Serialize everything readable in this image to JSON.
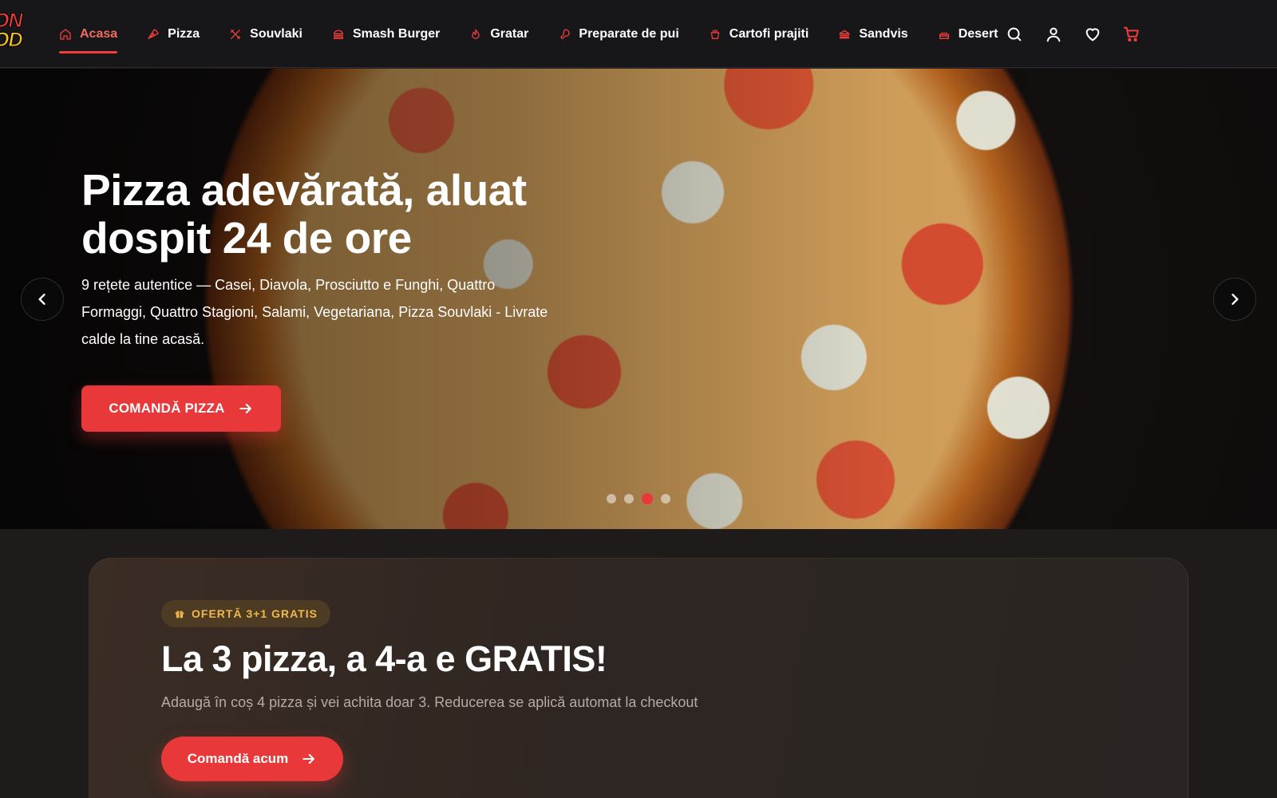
{
  "brand": {
    "logo_line1": "ON",
    "logo_line2": "OD"
  },
  "nav": {
    "items": [
      {
        "label": "Acasa",
        "icon": "home-icon",
        "active": true
      },
      {
        "label": "Pizza",
        "icon": "pizza-icon"
      },
      {
        "label": "Souvlaki",
        "icon": "utensils-icon"
      },
      {
        "label": "Smash Burger",
        "icon": "burger-icon"
      },
      {
        "label": "Gratar",
        "icon": "flame-icon"
      },
      {
        "label": "Preparate de pui",
        "icon": "drumstick-icon"
      },
      {
        "label": "Cartofi prajiti",
        "icon": "fries-icon"
      },
      {
        "label": "Sandvis",
        "icon": "sandwich-icon"
      },
      {
        "label": "Desert",
        "icon": "cake-icon"
      }
    ],
    "actions": [
      "search-icon",
      "user-icon",
      "heart-icon",
      "cart-icon"
    ]
  },
  "hero": {
    "title": "Pizza adevărată, aluat dospit 24 de ore",
    "description": "9 rețete autentice — Casei, Diavola, Prosciutto e Funghi, Quattro Formaggi, Quattro Stagioni, Salami, Vegetariana, Pizza Souvlaki - Livrate calde la tine acasă.",
    "cta_label": "COMANDĂ PIZZA",
    "slide_count": 4,
    "active_slide": 3
  },
  "offer": {
    "badge": "OFERTĂ 3+1 GRATIS",
    "title": "La 3 pizza, a 4-a e GRATIS!",
    "description": "Adaugă în coș 4 pizza și vei achita doar 3. Reducerea se aplică automat la checkout",
    "cta_label": "Comandă acum"
  },
  "colors": {
    "accent": "#e8383a",
    "nav_bg": "#17171a",
    "badge_text": "#f1b94b",
    "page_bg": "#1e1b1a"
  }
}
